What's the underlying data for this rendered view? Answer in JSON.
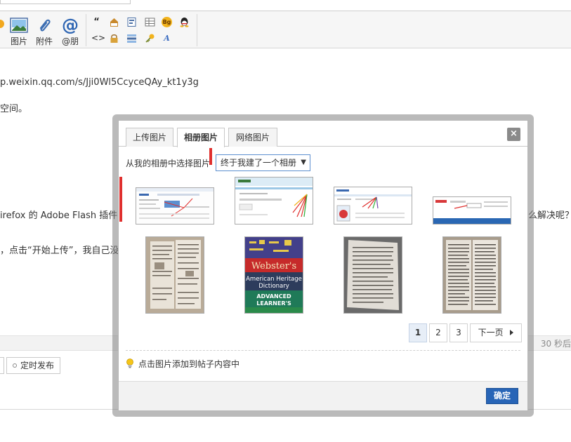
{
  "toolbar": {
    "image_label": "图片",
    "attachment_label": "附件",
    "mention_label": "@朋"
  },
  "content": {
    "url_line": "p.weixin.qq.com/s/Jji0Wl5CcyceQAy_kt1y3g",
    "line2": "空间。",
    "line3_left": "irefox 的 Adobe Flash 插件问",
    "line3_right": "么解决呢？",
    "line4": "，点击“开始上传”，我自己没"
  },
  "status": {
    "autosave": "30 秒后"
  },
  "bottom": {
    "schedule_label": "定时发布"
  },
  "dialog": {
    "tabs": [
      {
        "label": "上传图片",
        "active": false
      },
      {
        "label": "相册图片",
        "active": true
      },
      {
        "label": "网络图片",
        "active": false
      }
    ],
    "close_label": "×",
    "album_label": "从我的相册中选择图片",
    "album_selected": "终于我建了一个相册",
    "album_arrow": "▼",
    "thumbnails": [
      {
        "caption": ""
      },
      {
        "caption": ""
      },
      {
        "caption": ""
      },
      {
        "caption": ""
      },
      {
        "caption": ""
      },
      {
        "caption": "Webster's"
      },
      {
        "caption": ""
      },
      {
        "caption": ""
      }
    ],
    "book_spines": [
      "Webster's",
      "American Heritage",
      "Dictionary",
      "ADVANCED",
      "LEARNER'S"
    ],
    "pagination": {
      "pages": [
        "1",
        "2",
        "3"
      ],
      "current": "1",
      "next_label": "下一页"
    },
    "tip": "点击图片添加到帖子内容中",
    "confirm_label": "确定"
  },
  "colors": {
    "accent": "#2865b7",
    "marker": "#e0302e",
    "select_border": "#5c8fcf"
  }
}
